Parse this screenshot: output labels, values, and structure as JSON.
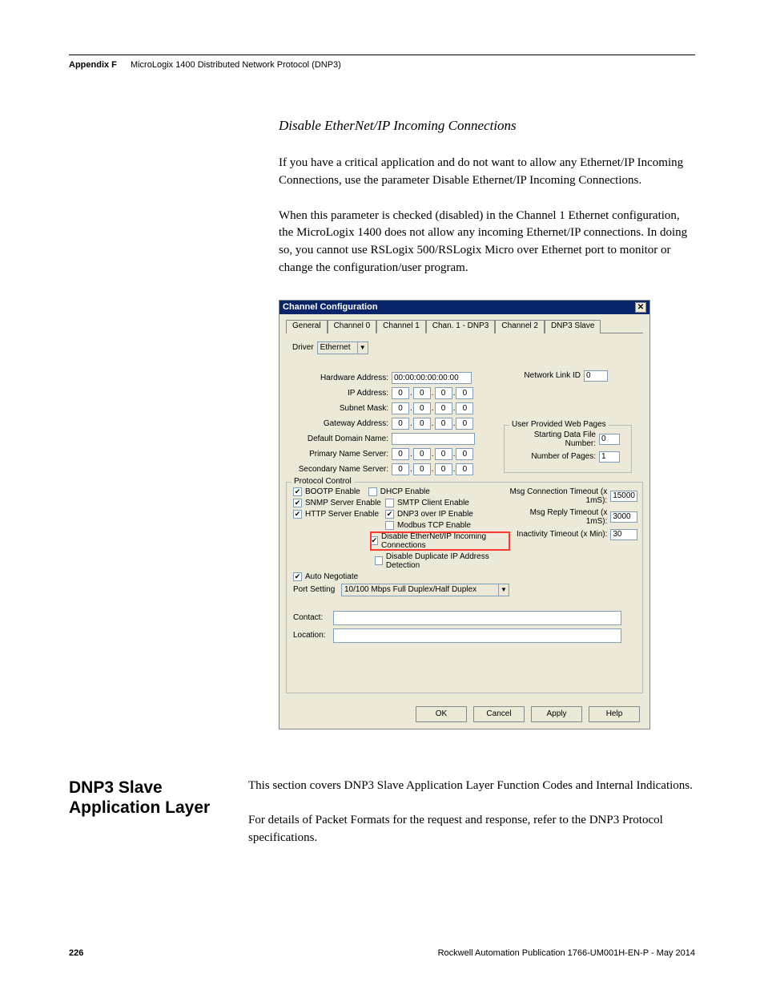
{
  "header": {
    "appendix": "Appendix F",
    "title": "MicroLogix 1400 Distributed Network Protocol (DNP3)"
  },
  "subheading": "Disable EtherNet/IP Incoming Connections",
  "para1": "If you have a critical application and do not want to allow any Ethernet/IP Incoming Connections, use the parameter Disable Ethernet/IP Incoming Connections.",
  "para2": "When this parameter is checked (disabled) in the Channel 1 Ethernet configuration, the MicroLogix 1400 does not allow any incoming Ethernet/IP connections. In doing so, you cannot use RSLogix 500/RSLogix Micro over Ethernet port to monitor or change the configuration/user program.",
  "dialog": {
    "title": "Channel Configuration",
    "tabs": [
      "General",
      "Channel 0",
      "Channel 1",
      "Chan. 1 - DNP3",
      "Channel 2",
      "DNP3 Slave"
    ],
    "active_tab": "Channel 1",
    "driver_label": "Driver",
    "driver_value": "Ethernet",
    "labels": {
      "hw": "Hardware Address:",
      "ip": "IP Address:",
      "subnet": "Subnet Mask:",
      "gateway": "Gateway Address:",
      "domain": "Default Domain Name:",
      "pns": "Primary Name Server:",
      "sns": "Secondary Name Server:",
      "netlink": "Network Link ID",
      "userweb": "User Provided Web Pages",
      "startfile": "Starting Data File Number:",
      "numpages": "Number of Pages:",
      "proto": "Protocol Control",
      "msgconn": "Msg Connection Timeout (x 1mS):",
      "msgreply": "Msg Reply Timeout (x 1mS):",
      "inact": "Inactivity Timeout (x Min):",
      "port": "Port Setting",
      "contact": "Contact:",
      "location": "Location:"
    },
    "values": {
      "hw": "00:00:00:00:00:00",
      "ip": [
        "0",
        "0",
        "0",
        "0"
      ],
      "subnet": [
        "0",
        "0",
        "0",
        "0"
      ],
      "gateway": [
        "0",
        "0",
        "0",
        "0"
      ],
      "domain": "",
      "pns": [
        "0",
        "0",
        "0",
        "0"
      ],
      "sns": [
        "0",
        "0",
        "0",
        "0"
      ],
      "netlink": "0",
      "startfile": "0",
      "numpages": "1",
      "msgconn": "15000",
      "msgreply": "3000",
      "inact": "30",
      "port": "10/100 Mbps Full Duplex/Half Duplex",
      "contact": "",
      "location": ""
    },
    "checkboxes": {
      "bootp": {
        "label": "BOOTP Enable",
        "checked": true
      },
      "dhcp": {
        "label": "DHCP Enable",
        "checked": false
      },
      "snmp": {
        "label": "SNMP Server Enable",
        "checked": true
      },
      "smtp": {
        "label": "SMTP Client Enable",
        "checked": false
      },
      "http": {
        "label": "HTTP Server Enable",
        "checked": true
      },
      "dnp3ip": {
        "label": "DNP3 over IP Enable",
        "checked": true
      },
      "modbus": {
        "label": "Modbus TCP Enable",
        "checked": false
      },
      "disable_eip": {
        "label": "Disable EtherNet/IP Incoming Connections",
        "checked": true
      },
      "disable_dup": {
        "label": "Disable Duplicate IP Address Detection",
        "checked": false
      },
      "autoneg": {
        "label": "Auto Negotiate",
        "checked": true
      }
    },
    "buttons": {
      "ok": "OK",
      "cancel": "Cancel",
      "apply": "Apply",
      "help": "Help"
    }
  },
  "section2": {
    "heading": "DNP3 Slave Application Layer",
    "p1": "This section covers DNP3 Slave Application Layer Function Codes and Internal Indications.",
    "p2": "For details of Packet Formats for the request and response, refer to the DNP3 Protocol specifications."
  },
  "footer": {
    "page": "226",
    "pub": "Rockwell Automation Publication 1766-UM001H-EN-P - May 2014"
  }
}
